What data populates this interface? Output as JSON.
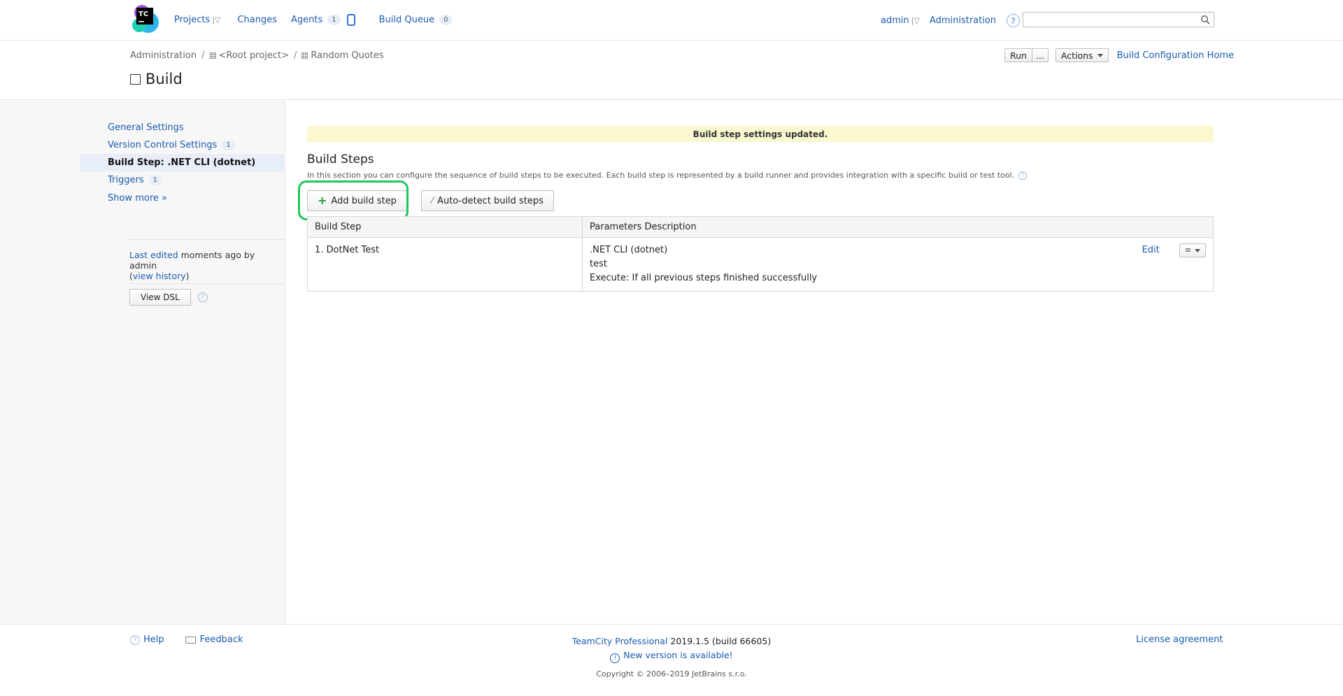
{
  "header": {
    "logo_text": "TC",
    "nav": {
      "projects": "Projects",
      "changes": "Changes",
      "agents": "Agents",
      "agents_count": "1",
      "build_queue": "Build Queue",
      "build_queue_count": "0"
    },
    "user": "admin",
    "administration": "Administration",
    "search": {
      "value": "",
      "placeholder": ""
    }
  },
  "breadcrumb": {
    "items": [
      "Administration",
      "<Root project>",
      "Random Quotes"
    ]
  },
  "page_title": "Build",
  "top_actions": {
    "run": "Run",
    "run_more": "...",
    "actions": "Actions",
    "home_link": "Build Configuration Home"
  },
  "sidebar": {
    "items": [
      {
        "label": "General Settings",
        "count": ""
      },
      {
        "label": "Version Control Settings",
        "count": "1"
      },
      {
        "label": "Build Step: .NET CLI (dotnet)",
        "count": ""
      },
      {
        "label": "Triggers",
        "count": "1"
      }
    ],
    "show_more": "Show more »",
    "last_edited_link": "Last edited",
    "last_edited_text": "moments ago by admin",
    "view_history_open": "(",
    "view_history": "view history",
    "view_history_close": ")",
    "view_dsl": "View DSL"
  },
  "main": {
    "notice": "Build step settings updated.",
    "section_title": "Build Steps",
    "section_desc": "In this section you can configure the sequence of build steps to be executed. Each build step is represented by a build runner and provides integration with a specific build or test tool.",
    "add_build_step": "Add build step",
    "auto_detect": "Auto-detect build steps",
    "table": {
      "headers": [
        "Build Step",
        "Parameters Description"
      ],
      "rows": [
        {
          "step": "1. DotNet Test",
          "runner": ".NET CLI (dotnet)",
          "command": "test",
          "execute": "Execute: If all previous steps finished successfully",
          "edit": "Edit"
        }
      ]
    }
  },
  "footer": {
    "help": "Help",
    "feedback": "Feedback",
    "product_link": "TeamCity Professional",
    "version": "2019.1.5 (build 66605)",
    "new_version": "New version is available!",
    "copyright": "Copyright © 2006–2019 JetBrains s.r.o.",
    "license": "License agreement"
  },
  "colors": {
    "link": "#1a5bb0",
    "notice_bg": "#fbf8d0",
    "highlight": "#22c55e",
    "sidebar_active_bg": "#e7eef8"
  }
}
